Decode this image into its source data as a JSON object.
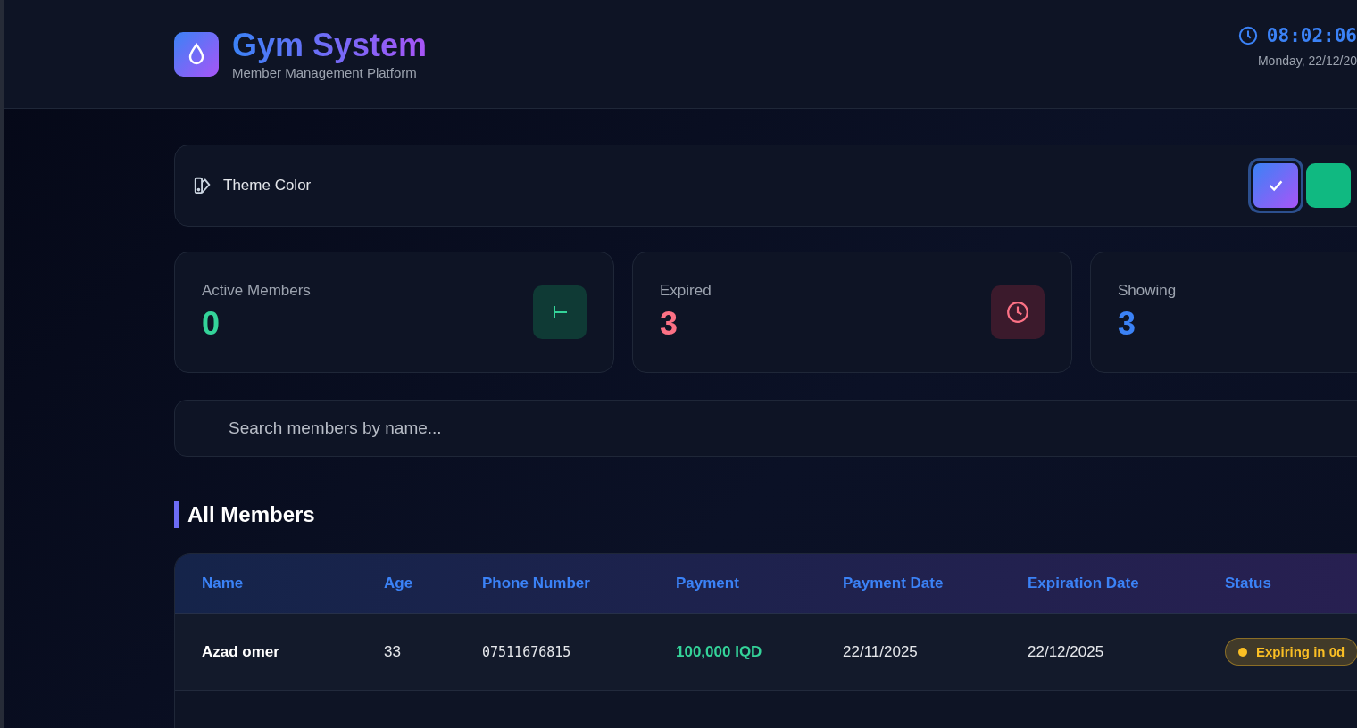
{
  "header": {
    "title": "Gym System",
    "subtitle": "Member Management Platform",
    "time": "08:02:06",
    "date": "Monday, 22/12/20"
  },
  "theme": {
    "label": "Theme Color",
    "swatches": [
      {
        "color": "#6366f1",
        "selected": true
      },
      {
        "color": "#10b981",
        "selected": false
      }
    ]
  },
  "stats": [
    {
      "label": "Active Members",
      "value": "0",
      "kind": "active",
      "color": "#34d399"
    },
    {
      "label": "Expired",
      "value": "3",
      "kind": "expired",
      "color": "#fb7185"
    },
    {
      "label": "Showing",
      "value": "3",
      "kind": "showing",
      "color": "#3b82f6"
    }
  ],
  "search": {
    "placeholder": "Search members by name..."
  },
  "section_title": "All Members",
  "table": {
    "columns": [
      "Name",
      "Age",
      "Phone Number",
      "Payment",
      "Payment Date",
      "Expiration Date",
      "Status"
    ],
    "rows": [
      {
        "name": "Azad omer",
        "age": "33",
        "phone": "07511676815",
        "payment": "100,000 IQD",
        "payment_date": "22/11/2025",
        "expiration_date": "22/12/2025",
        "status": {
          "text": "Expiring in 0d",
          "color": "#fbbf24"
        }
      }
    ]
  }
}
